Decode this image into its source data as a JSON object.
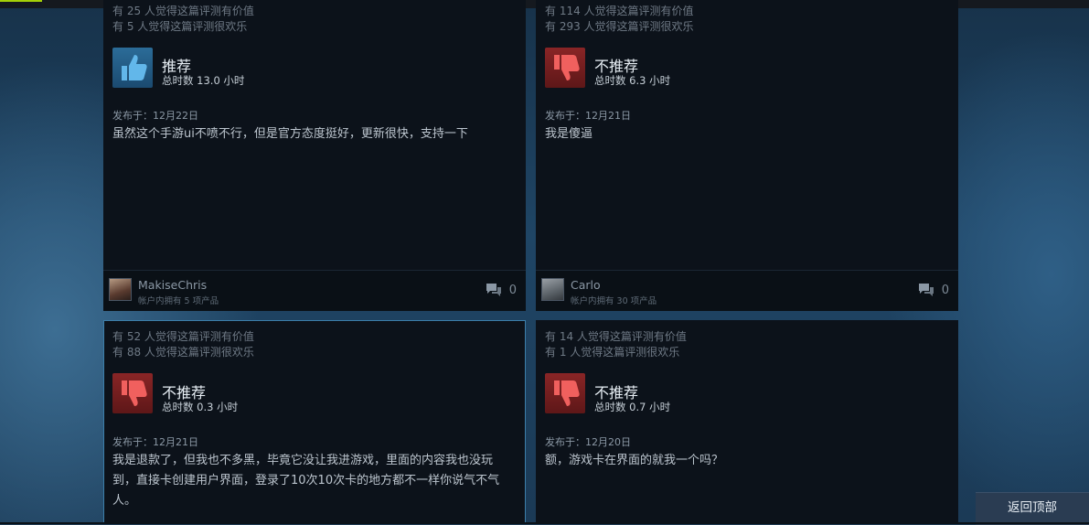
{
  "reviews": [
    {
      "helpful": "有 25 人觉得这篇评测有价值",
      "funny": "有 5 人觉得这篇评测很欢乐",
      "icon": "thumbs-up",
      "verdict": "推荐",
      "hours": "总时数 13.0 小时",
      "posted": "发布于：12月22日",
      "text": "虽然这个手游ui不喷不行，但是官方态度挺好，更新很快，支持一下",
      "author": "MakiseChris",
      "products": "帐户内拥有 5 项产品",
      "comments": "0"
    },
    {
      "helpful": "有 114 人觉得这篇评测有价值",
      "funny": "有 293 人觉得这篇评测很欢乐",
      "icon": "thumbs-down",
      "verdict": "不推荐",
      "hours": "总时数 6.3 小时",
      "posted": "发布于：12月21日",
      "text": "我是傻逼",
      "author": "Carlo",
      "products": "帐户内拥有 30 项产品",
      "comments": "0"
    },
    {
      "helpful": "有 52 人觉得这篇评测有价值",
      "funny": "有 88 人觉得这篇评测很欢乐",
      "icon": "thumbs-down",
      "verdict": "不推荐",
      "hours": "总时数 0.3 小时",
      "posted": "发布于：12月21日",
      "text": "我是退款了，但我也不多黑，毕竟它没让我进游戏，里面的内容我也没玩到，直接卡创建用户界面，登录了10次10次卡的地方都不一样你说气不气人。"
    },
    {
      "helpful": "有 14 人觉得这篇评测有价值",
      "funny": "有 1 人觉得这篇评测很欢乐",
      "icon": "thumbs-down",
      "verdict": "不推荐",
      "hours": "总时数 0.7 小时",
      "posted": "发布于：12月20日",
      "text": "额，游戏卡在界面的就我一个吗？"
    }
  ],
  "back_to_top": "返回顶部",
  "colors": {
    "recommend_blue": "#2b6c98",
    "not_recommend_red": "#8a2526",
    "card_bg": "#0c121a",
    "accent_green": "#a4d007"
  }
}
